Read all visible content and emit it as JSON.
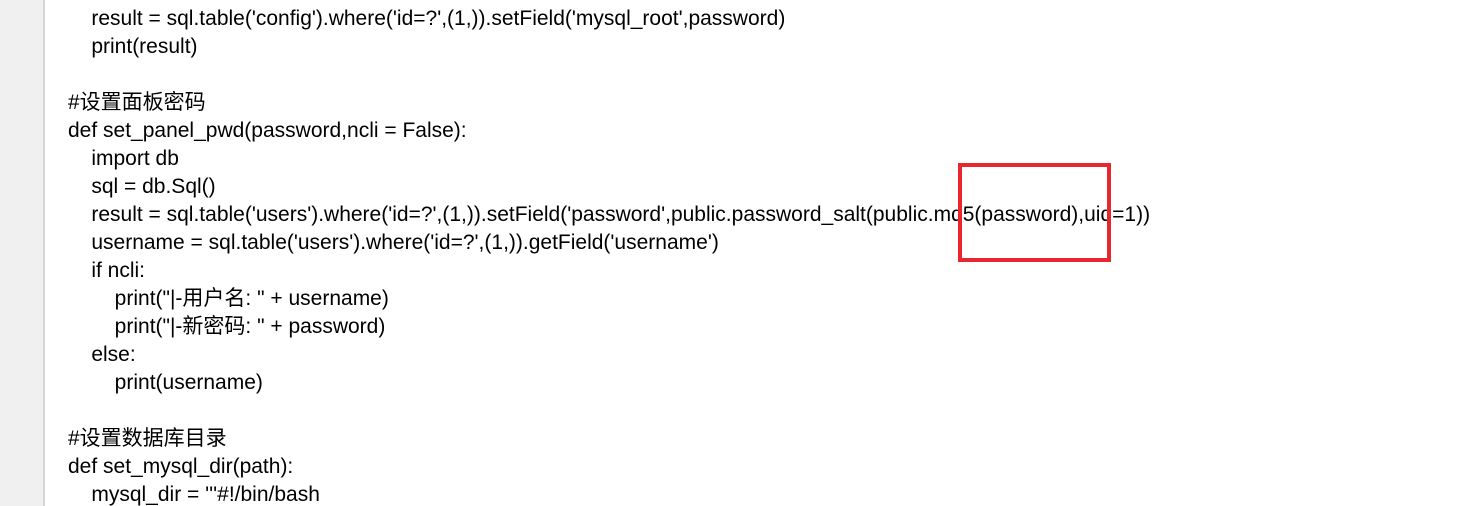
{
  "code_lines": [
    "    result = sql.table('config').where('id=?',(1,)).setField('mysql_root',password)",
    "    print(result)",
    "",
    "#设置面板密码",
    "def set_panel_pwd(password,ncli = False):",
    "    import db",
    "    sql = db.Sql()",
    "    result = sql.table('users').where('id=?',(1,)).setField('password',public.password_salt(public.md5(password),uid=1))",
    "    username = sql.table('users').where('id=?',(1,)).getField('username')",
    "    if ncli:",
    "        print(\"|-用户名: \" + username)",
    "        print(\"|-新密码: \" + password)",
    "    else:",
    "        print(username)",
    "",
    "#设置数据库目录",
    "def set_mysql_dir(path):",
    "    mysql_dir = '''#!/bin/bash"
  ],
  "highlight": {
    "color": "#e8262f",
    "target_text": "public.md5(password)"
  }
}
